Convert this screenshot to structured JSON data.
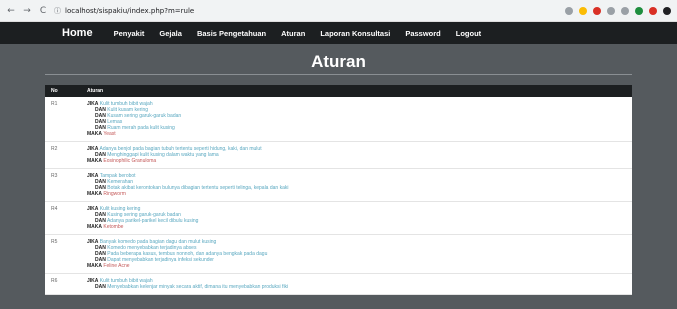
{
  "browser": {
    "url": "localhost/sispakiu/index.php?m=rule",
    "back": "←",
    "forward": "→",
    "reload": "C",
    "info": "ⓘ"
  },
  "nav": {
    "brand": "Home",
    "items": [
      "Penyakit",
      "Gejala",
      "Basis Pengetahuan",
      "Aturan",
      "Laporan Konsultasi",
      "Password",
      "Logout"
    ]
  },
  "page_title": "Aturan",
  "table": {
    "headers": [
      "No",
      "Aturan"
    ],
    "rows": [
      {
        "no": "R1",
        "lines": [
          {
            "kw": "JIKA",
            "text": "Kulit tumbuh bibit wajah",
            "type": "cond",
            "indent": false
          },
          {
            "kw": "DAN",
            "text": "Kulit kusam kering",
            "type": "cond",
            "indent": true
          },
          {
            "kw": "DAN",
            "text": "Kusam sering garuk-garuk badan",
            "type": "cond",
            "indent": true
          },
          {
            "kw": "DAN",
            "text": "Lemas",
            "type": "cond",
            "indent": true
          },
          {
            "kw": "DAN",
            "text": "Ruam merah pada kulit kusing",
            "type": "cond",
            "indent": true
          },
          {
            "kw": "MAKA",
            "text": "Yeast",
            "type": "res",
            "indent": false
          }
        ]
      },
      {
        "no": "R2",
        "lines": [
          {
            "kw": "JIKA",
            "text": "Adanya benjol pada bagian tubuh tertentu seperti hidung, kaki, dan mulut",
            "type": "cond",
            "indent": false
          },
          {
            "kw": "DAN",
            "text": "Menghinggapi kulit kusing dalam waktu yang lama",
            "type": "cond",
            "indent": true
          },
          {
            "kw": "MAKA",
            "text": "Eosinophilic Granuloma",
            "type": "res",
            "indent": false
          }
        ]
      },
      {
        "no": "R3",
        "lines": [
          {
            "kw": "JIKA",
            "text": "Tampak berobot",
            "type": "cond",
            "indent": false
          },
          {
            "kw": "DAN",
            "text": "Kemerahan",
            "type": "cond",
            "indent": true
          },
          {
            "kw": "DAN",
            "text": "Botak akibat kerontokan bulunya dibagian tertentu seperti telinga, kepala dan kaki",
            "type": "cond",
            "indent": true
          },
          {
            "kw": "MAKA",
            "text": "Ringworm",
            "type": "res",
            "indent": false
          }
        ]
      },
      {
        "no": "R4",
        "lines": [
          {
            "kw": "JIKA",
            "text": "Kulit kusing kering",
            "type": "cond",
            "indent": false
          },
          {
            "kw": "DAN",
            "text": "Kusing sering garuk-garuk badan",
            "type": "cond",
            "indent": true
          },
          {
            "kw": "DAN",
            "text": "Adanya parikel-parikel kecil dibulu kusing",
            "type": "cond",
            "indent": true
          },
          {
            "kw": "MAKA",
            "text": "Ketombe",
            "type": "res",
            "indent": false
          }
        ]
      },
      {
        "no": "R5",
        "lines": [
          {
            "kw": "JIKA",
            "text": "Banyak komedo pada bagian dagu dan mulut kusing",
            "type": "cond",
            "indent": false
          },
          {
            "kw": "DAN",
            "text": "Komedo menyebabkan terjadinya abses",
            "type": "cond",
            "indent": true
          },
          {
            "kw": "DAN",
            "text": "Pada beberapa kasus, tembus nonnoh, dan adanya bengkak pada dagu",
            "type": "cond",
            "indent": true
          },
          {
            "kw": "DAN",
            "text": "Dapat menyebabkan terjadinya infeksi sekunder",
            "type": "cond",
            "indent": true
          },
          {
            "kw": "MAKA",
            "text": "Feline Acne",
            "type": "res",
            "indent": false
          }
        ]
      },
      {
        "no": "R6",
        "lines": [
          {
            "kw": "JIKA",
            "text": "Kulit tumbuh bibit wajah",
            "type": "cond",
            "indent": false
          },
          {
            "kw": "DAN",
            "text": "Menyebabkan kelenjar minyak secara aktif, dimana itu menyebabkan produksi fiki",
            "type": "cond",
            "indent": true
          }
        ]
      }
    ]
  },
  "colors": {
    "nav_bg": "#1c1f21",
    "page_bg": "#555a5e",
    "condition_text": "#5aa8c0",
    "result_text": "#c45a5a"
  }
}
